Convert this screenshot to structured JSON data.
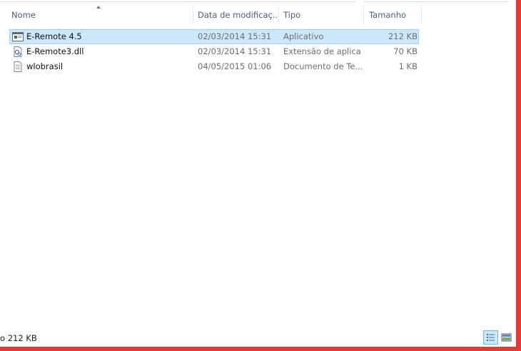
{
  "columns": {
    "name": "Nome",
    "date": "Data de modificaç...",
    "type": "Tipo",
    "size": "Tamanho"
  },
  "files": [
    {
      "name": "E-Remote 4.5",
      "date": "02/03/2014 15:31",
      "type": "Aplicativo",
      "size": "212 KB",
      "icon": "application-icon",
      "selected": true
    },
    {
      "name": "E-Remote3.dll",
      "date": "02/03/2014 15:31",
      "type": "Extensão de aplica...",
      "size": "70 KB",
      "icon": "dll-file-icon",
      "selected": false
    },
    {
      "name": "wlobrasil",
      "date": "04/05/2015 01:06",
      "type": "Documento de Te...",
      "size": "1 KB",
      "icon": "text-document-icon",
      "selected": false
    }
  ],
  "status": {
    "text": "o  212 KB"
  },
  "colors": {
    "selection_bg": "#cce8ff",
    "selection_border": "#99d1ff",
    "header_text": "#4c607a",
    "frame": "#e53935"
  }
}
